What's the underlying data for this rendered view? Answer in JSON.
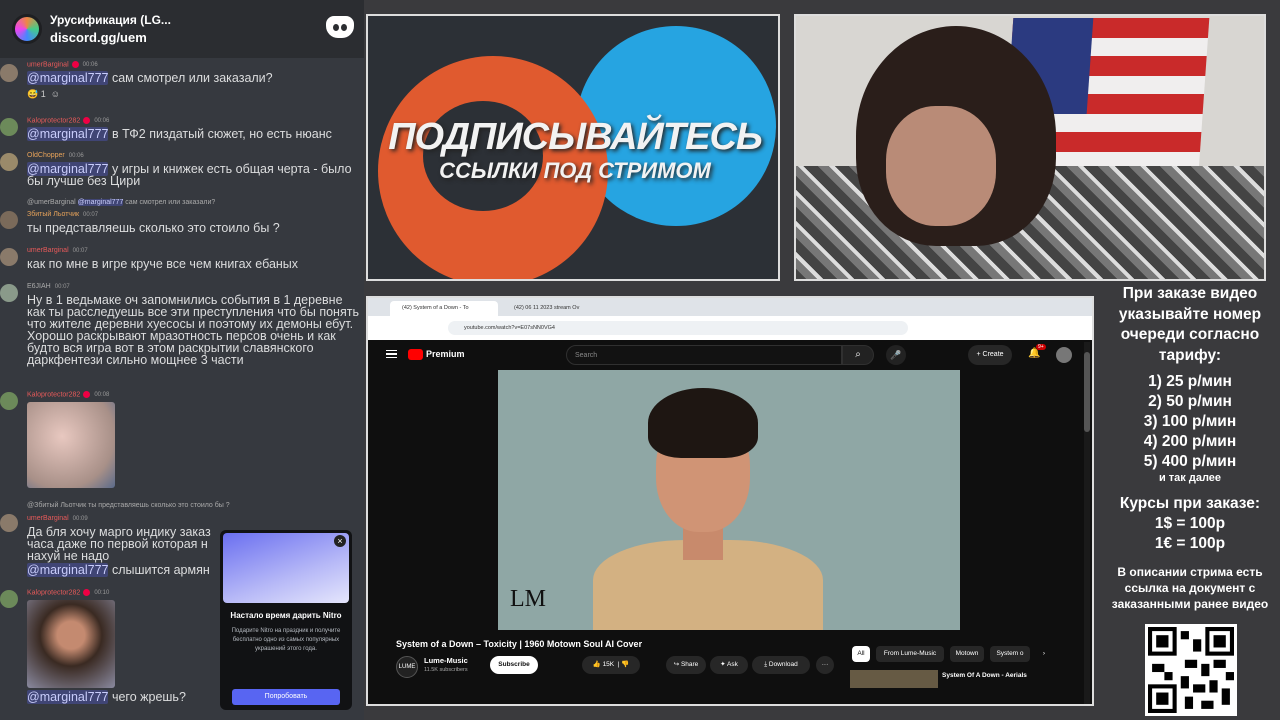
{
  "chat": {
    "server_name": "Урусификация (LG...",
    "server_invite": "discord.gg/uem",
    "messages": [
      {
        "user": "umerBarginal",
        "time": "00:06",
        "text": "сам смотрел или заказали?",
        "mention": "@marginal777",
        "reactions": "1"
      },
      {
        "user": "Kaloprotector282",
        "time": "00:06",
        "mention": "@marginal777",
        "text": "в ТФ2 пиздатый сюжет, но есть нюанс"
      },
      {
        "user": "OldChopper",
        "time": "00:06",
        "mention": "@marginal777",
        "text": "у игры и книжек есть общая черта - было бы лучше без Цири"
      },
      {
        "reply_user": "@umerBarginal",
        "reply_mention": "@marginal777",
        "reply_text": "сам смотрел или заказали?",
        "user": "Збитый Льотчик",
        "time": "00:07",
        "text": "ты представляешь сколько это стоило бы ?"
      },
      {
        "user": "umerBarginal",
        "time": "00:07",
        "text": "как по мне в игре круче все чем книгах ебаных"
      },
      {
        "user": "E6JIAH",
        "time": "00:07",
        "text": "Ну в 1 ведьмаке оч запомнились события в 1 деревне как ты расследуешь все эти преступления что бы понять что жителе деревни хуесосы и поэтому их демоны ебут. Хорошо раскрывают мразотность персов очень и как будто вся игра вот в этом раскрытии славянского даркфентези сильно мощнее 3 части"
      },
      {
        "user": "Kaloprotector282",
        "time": "00:08"
      },
      {
        "reply_user": "@Збитый Льотчик",
        "reply_text": "ты представляешь сколько это стоило бы ?",
        "user": "umerBarginal",
        "time": "00:09",
        "text": "Да бля хочу марго индику заказ",
        "text2": "часа даже по первой которая н",
        "text3": "нахуй не надо",
        "mention": "@marginal777",
        "text4": "слышится армян"
      },
      {
        "user": "Kaloprotector282",
        "time": "00:10",
        "mention": "@marginal777",
        "text": "чего жрешь?"
      }
    ]
  },
  "nitro": {
    "title": "Настало время дарить Nitro",
    "desc": "Подарите Nitro на праздник и получите бесплатно одно из самых популярных украшений этого года.",
    "button": "Попробовать",
    "close": "×"
  },
  "banner": {
    "title": "ПОДПИСЫВАЙТЕСЬ",
    "subtitle": "ССЫЛКИ ПОД СТРИМОМ"
  },
  "browser": {
    "tab1": "(42) System of a Down - To",
    "tab2": "(42) 06 11 2023 stream Ov",
    "url": "youtube.com/watch?v=E07sNN0VG4"
  },
  "youtube": {
    "logo": "Premium",
    "search_placeholder": "Search",
    "create": "Create",
    "notif_count": "9+",
    "video_logo": "LM",
    "title": "System of a Down – Toxicity | 1960 Motown Soul AI Cover",
    "channel_avatar": "LUME",
    "channel": "Lume-Music",
    "subs": "11.5K subscribers",
    "subscribe": "Subscribe",
    "likes": "15K",
    "share": "Share",
    "ask": "Ask",
    "download": "Download",
    "more": "···",
    "chips": [
      "All",
      "From Lume-Music",
      "Motown",
      "System o"
    ],
    "rec_title": "System Of A Down - Aerials"
  },
  "info": {
    "order_title": "При заказе видео указывайте номер очереди согласно тарифу:",
    "prices": [
      "1) 25 р/мин",
      "2) 50 р/мин",
      "3) 100 р/мин",
      "4) 200 р/мин",
      "5) 400 р/мин"
    ],
    "etc": "и так далее",
    "courses_title": "Курсы при заказе:",
    "courses": [
      "1$ = 100р",
      "1€ = 100р"
    ],
    "desc": "В описании стрима есть ссылка на документ с заказанными ранее видео"
  }
}
